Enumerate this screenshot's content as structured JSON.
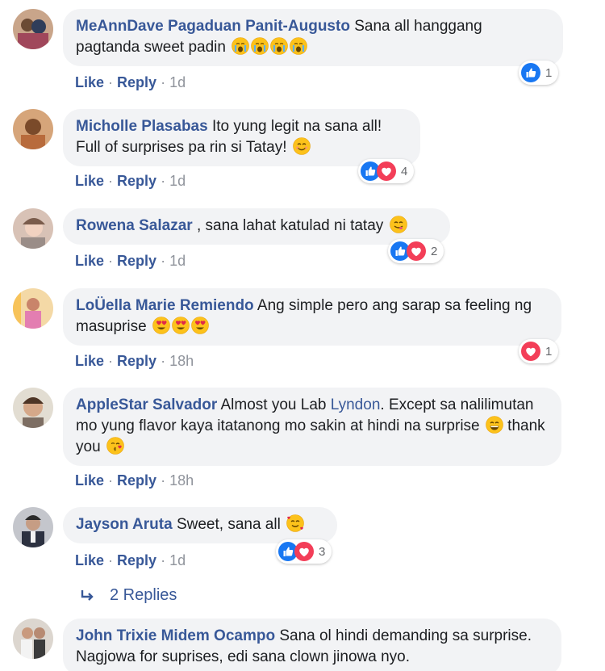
{
  "colors": {
    "link": "#385898",
    "meta": "#90949c",
    "bubble": "#f2f3f5",
    "like": "#1877f2",
    "love": "#f33e58"
  },
  "comments": [
    {
      "author": "MeAnnDave Pagaduan Panit-Augusto",
      "text": " Sana all hanggang pagtanda sweet padin",
      "emojis": [
        "crying-face",
        "crying-face",
        "crying-face",
        "crying-face"
      ],
      "actions": {
        "like": "Like",
        "reply": "Reply",
        "time": "1d"
      },
      "reactions": {
        "types": [
          "like"
        ],
        "count": "1"
      }
    },
    {
      "author": "Micholle Plasabas",
      "text": " Ito yung legit na sana all! Full of surprises pa rin si Tatay!",
      "emojis": [
        "smiling-face"
      ],
      "actions": {
        "like": "Like",
        "reply": "Reply",
        "time": "1d"
      },
      "reactions": {
        "types": [
          "like",
          "love"
        ],
        "count": "4"
      }
    },
    {
      "author": "Rowena Salazar",
      "text": " , sana lahat katulad ni tatay",
      "emojis": [
        "yum-face"
      ],
      "actions": {
        "like": "Like",
        "reply": "Reply",
        "time": "1d"
      },
      "reactions": {
        "types": [
          "like",
          "love"
        ],
        "count": "2"
      }
    },
    {
      "author": "LoÜella Marie Remiendo",
      "text": " Ang simple pero ang sarap sa feeling ng masuprise",
      "emojis": [
        "heart-eyes-face",
        "heart-eyes-face",
        "heart-eyes-face"
      ],
      "actions": {
        "like": "Like",
        "reply": "Reply",
        "time": "18h"
      },
      "reactions": {
        "types": [
          "love"
        ],
        "count": "1"
      }
    },
    {
      "author": "AppleStar Salvador",
      "text": " Almost you Lab ",
      "mention": "Lyndon",
      "text2": ". Except sa nalilimutan mo yung flavor kaya itatanong mo sakin at hindi na surprise",
      "text3": " thank you",
      "emojis": [
        "grinning-face"
      ],
      "emojis2": [
        "kissing-face"
      ],
      "actions": {
        "like": "Like",
        "reply": "Reply",
        "time": "18h"
      }
    },
    {
      "author": "Jayson Aruta",
      "text": " Sweet, sana all",
      "emojis": [
        "hearts-face"
      ],
      "actions": {
        "like": "Like",
        "reply": "Reply",
        "time": "1d"
      },
      "reactions": {
        "types": [
          "like",
          "love"
        ],
        "count": "3"
      }
    },
    {
      "author": "John Trixie Midem Ocampo",
      "text": " Sana ol hindi demanding sa surprise. Nagjowa for suprises, edi sana clown jinowa nyo."
    }
  ],
  "replies_link": "2 Replies"
}
